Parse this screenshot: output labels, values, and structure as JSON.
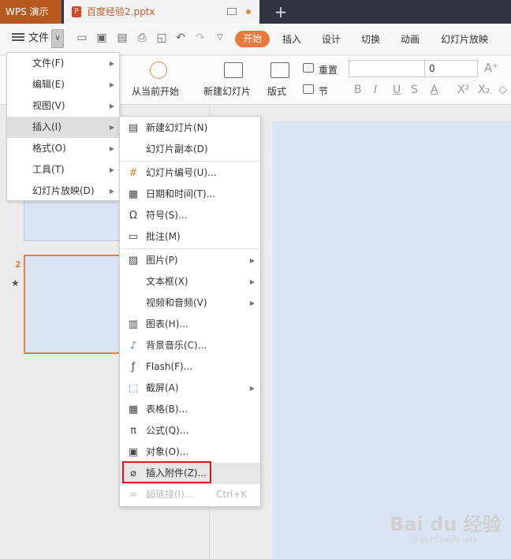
{
  "titlebar": {
    "app_name": "WPS 演示",
    "doc_name": "百度经验2.pptx",
    "doc_icon_letter": "P"
  },
  "toolbar": {
    "file_label": "文件",
    "tabs": [
      "开始",
      "插入",
      "设计",
      "切换",
      "动画",
      "幻灯片放映"
    ],
    "active_tab": "开始"
  },
  "ribbon": {
    "from_current": "从当前开始",
    "new_slide": "新建幻灯片",
    "layout": "版式",
    "reset": "重置",
    "section": "节",
    "font_size": "0"
  },
  "file_menu": {
    "items": [
      {
        "label": "文件(F)"
      },
      {
        "label": "编辑(E)"
      },
      {
        "label": "视图(V)"
      },
      {
        "label": "插入(I)"
      },
      {
        "label": "格式(O)"
      },
      {
        "label": "工具(T)"
      },
      {
        "label": "幻灯片放映(D)"
      }
    ],
    "active_index": 3
  },
  "insert_menu": {
    "items": [
      {
        "label": "新建幻灯片(N)",
        "icon": "new-slide-icon"
      },
      {
        "label": "幻灯片副本(D)",
        "icon": ""
      },
      {
        "label": "幻灯片编号(U)...",
        "icon": "slide-number-icon"
      },
      {
        "label": "日期和时间(T)...",
        "icon": "calendar-icon"
      },
      {
        "label": "符号(S)...",
        "icon": "omega-icon"
      },
      {
        "label": "批注(M)",
        "icon": "comment-icon"
      },
      {
        "label": "图片(P)",
        "icon": "picture-icon"
      },
      {
        "label": "文本框(X)",
        "icon": ""
      },
      {
        "label": "视频和音频(V)",
        "icon": ""
      },
      {
        "label": "图表(H)...",
        "icon": "chart-icon"
      },
      {
        "label": "背景音乐(C)...",
        "icon": "music-note-icon"
      },
      {
        "label": "Flash(F)...",
        "icon": "flash-icon"
      },
      {
        "label": "截屏(A)",
        "icon": "screenshot-icon"
      },
      {
        "label": "表格(B)...",
        "icon": "table-icon"
      },
      {
        "label": "公式(Q)...",
        "icon": "pi-icon"
      },
      {
        "label": "对象(O)...",
        "icon": "object-icon"
      },
      {
        "label": "插入附件(Z)...",
        "icon": "paperclip-icon"
      },
      {
        "label": "超链接(I)...",
        "icon": "link-icon",
        "shortcut": "Ctrl+K"
      }
    ],
    "highlighted": "插入附件(Z)..."
  },
  "slides": {
    "second_number": "2"
  },
  "watermark": {
    "brand": "Bai du 经验",
    "url": "jingyan.baidu.com"
  },
  "colors": {
    "accent": "#e77a3a",
    "highlight_box": "#e0161b",
    "slide_bg": "#dbe4f3"
  }
}
